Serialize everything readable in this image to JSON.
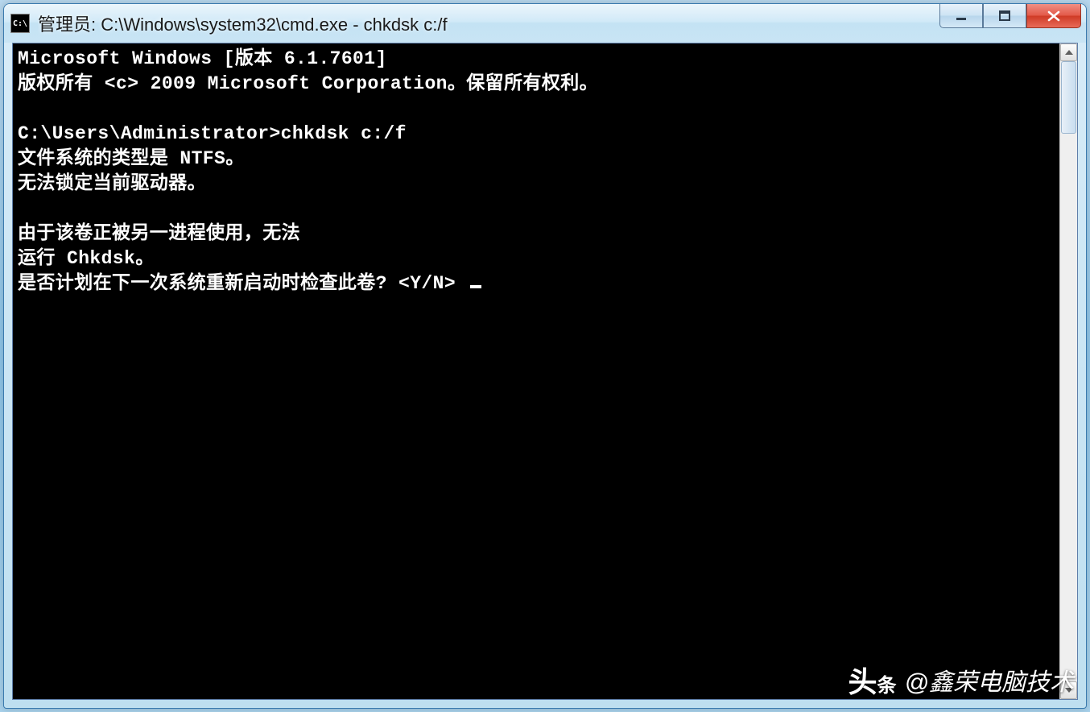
{
  "window": {
    "title": "管理员: C:\\Windows\\system32\\cmd.exe - chkdsk  c:/f",
    "icon_label": "C:\\"
  },
  "console": {
    "lines": [
      "Microsoft Windows [版本 6.1.7601]",
      "版权所有 <c> 2009 Microsoft Corporation。保留所有权利。",
      "",
      "C:\\Users\\Administrator>chkdsk c:/f",
      "文件系统的类型是 NTFS。",
      "无法锁定当前驱动器。",
      "",
      "由于该卷正被另一进程使用，无法",
      "运行 Chkdsk。",
      "是否计划在下一次系统重新启动时检查此卷? <Y/N> "
    ]
  },
  "watermark": {
    "logo_big": "头",
    "logo_small": "条",
    "handle": "@鑫荣电脑技术"
  }
}
